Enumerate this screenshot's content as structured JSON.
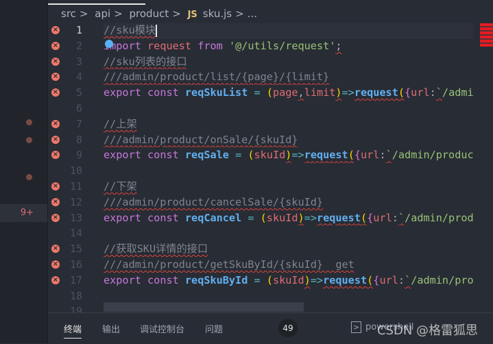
{
  "breadcrumb": {
    "items": [
      "src",
      "api",
      "product"
    ],
    "file_icon": "JS",
    "file": "sku.js",
    "more": "..."
  },
  "gutter": {
    "problems_badge": "9+"
  },
  "lines": [
    {
      "n": "1",
      "err": true,
      "tokens": [
        [
          "c",
          "//sku模块",
          1
        ]
      ]
    },
    {
      "n": "2",
      "err": true,
      "tokens": [
        [
          "k",
          "import"
        ],
        [
          "t",
          " "
        ],
        [
          "v",
          "request"
        ],
        [
          "t",
          " "
        ],
        [
          "k",
          "from"
        ],
        [
          "t",
          " "
        ],
        [
          "s",
          "'@/utils/request'"
        ],
        [
          "t",
          ";",
          1
        ]
      ]
    },
    {
      "n": "3",
      "err": true,
      "tokens": [
        [
          "c",
          "//sku列表的接口",
          1
        ]
      ]
    },
    {
      "n": "4",
      "err": true,
      "tokens": [
        [
          "c",
          "///admin/product/list/{page}/{limit}",
          1
        ]
      ]
    },
    {
      "n": "5",
      "err": true,
      "tokens": [
        [
          "k",
          "export"
        ],
        [
          "t",
          " "
        ],
        [
          "k",
          "const"
        ],
        [
          "t",
          " "
        ],
        [
          "f",
          "reqSkuList"
        ],
        [
          "o",
          " = "
        ],
        [
          "p",
          "("
        ],
        [
          "v",
          "page"
        ],
        [
          "t",
          ",",
          1
        ],
        [
          "v",
          "limit"
        ],
        [
          "p",
          ")",
          1
        ],
        [
          "o",
          "=>"
        ],
        [
          "f",
          "request",
          1
        ],
        [
          "p",
          "(",
          1
        ],
        [
          "b",
          "{"
        ],
        [
          "v",
          "url"
        ],
        [
          "t",
          ":"
        ],
        [
          "s",
          "`",
          1
        ],
        [
          "s",
          "/admin/product/list/${page}/${limit}`"
        ]
      ]
    },
    {
      "n": "6",
      "err": false,
      "tokens": []
    },
    {
      "n": "7",
      "err": true,
      "tokens": [
        [
          "c",
          "//上架",
          1
        ]
      ]
    },
    {
      "n": "8",
      "err": true,
      "tokens": [
        [
          "c",
          "///admin/product/onSale/{skuId}",
          1
        ]
      ]
    },
    {
      "n": "9",
      "err": true,
      "tokens": [
        [
          "k",
          "export"
        ],
        [
          "t",
          " "
        ],
        [
          "k",
          "const"
        ],
        [
          "t",
          " "
        ],
        [
          "f",
          "reqSale"
        ],
        [
          "o",
          " = "
        ],
        [
          "p",
          "("
        ],
        [
          "v",
          "skuId"
        ],
        [
          "p",
          ")",
          1
        ],
        [
          "o",
          "=>"
        ],
        [
          "f",
          "request",
          1
        ],
        [
          "p",
          "(",
          1
        ],
        [
          "b",
          "{"
        ],
        [
          "v",
          "url"
        ],
        [
          "t",
          ":"
        ],
        [
          "s",
          "`",
          1
        ],
        [
          "s",
          "/admin/product/onSale/${skuId}`"
        ]
      ]
    },
    {
      "n": "10",
      "err": false,
      "tokens": []
    },
    {
      "n": "11",
      "err": true,
      "tokens": [
        [
          "c",
          "//下架",
          1
        ]
      ]
    },
    {
      "n": "12",
      "err": true,
      "tokens": [
        [
          "c",
          "///admin/product/cancelSale/{skuId}",
          1
        ]
      ]
    },
    {
      "n": "13",
      "err": true,
      "tokens": [
        [
          "k",
          "export"
        ],
        [
          "t",
          " "
        ],
        [
          "k",
          "const"
        ],
        [
          "t",
          " "
        ],
        [
          "f",
          "reqCancel"
        ],
        [
          "o",
          " = "
        ],
        [
          "p",
          "("
        ],
        [
          "v",
          "skuId"
        ],
        [
          "p",
          ")",
          1
        ],
        [
          "o",
          "=>"
        ],
        [
          "f",
          "request",
          1
        ],
        [
          "p",
          "(",
          1
        ],
        [
          "b",
          "{"
        ],
        [
          "v",
          "url"
        ],
        [
          "t",
          ":"
        ],
        [
          "s",
          "`",
          1
        ],
        [
          "s",
          "/admin/product/cancelSale/${skuId}`"
        ]
      ]
    },
    {
      "n": "14",
      "err": false,
      "tokens": []
    },
    {
      "n": "15",
      "err": true,
      "tokens": [
        [
          "c",
          "//获取SKU详情的接口",
          1
        ]
      ]
    },
    {
      "n": "16",
      "err": true,
      "tokens": [
        [
          "c",
          "///admin/product/getSkuById/{skuId}  get",
          1
        ]
      ]
    },
    {
      "n": "17",
      "err": true,
      "tokens": [
        [
          "k",
          "export"
        ],
        [
          "t",
          " "
        ],
        [
          "k",
          "const"
        ],
        [
          "t",
          " "
        ],
        [
          "f",
          "reqSkuById"
        ],
        [
          "o",
          " = "
        ],
        [
          "p",
          "("
        ],
        [
          "v",
          "skuId"
        ],
        [
          "p",
          ")",
          1
        ],
        [
          "o",
          "=>"
        ],
        [
          "f",
          "request",
          1
        ],
        [
          "p",
          "(",
          1
        ],
        [
          "b",
          "{"
        ],
        [
          "v",
          "url"
        ],
        [
          "t",
          ":"
        ],
        [
          "s",
          "`",
          1
        ],
        [
          "s",
          "/admin/product/getSkuById/${skuId}`"
        ]
      ]
    },
    {
      "n": "18",
      "err": false,
      "tokens": []
    },
    {
      "n": "19",
      "err": false,
      "tokens": []
    }
  ],
  "panel": {
    "tabs": [
      "终端",
      "输出",
      "调试控制台",
      "问题"
    ],
    "active_tab": "终端",
    "problems_count": "49",
    "shell": "powershell"
  },
  "watermark": "CSDN @格雷狐思",
  "colors": {
    "error": "#f0786a",
    "keyword": "#c678dd",
    "function": "#61afef",
    "string": "#98c379",
    "variable": "#e06c75",
    "comment": "#7f848e"
  }
}
